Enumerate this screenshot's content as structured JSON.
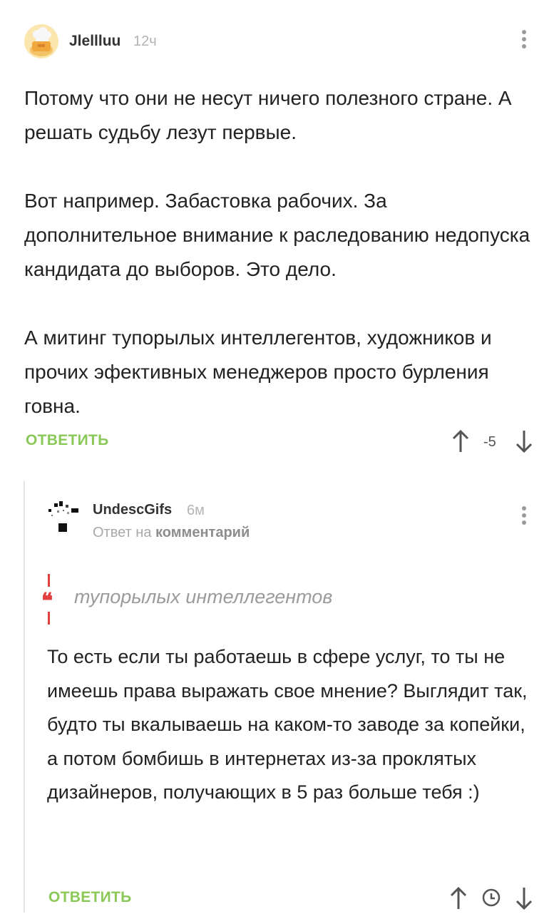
{
  "comment": {
    "username": "Jlellluu",
    "time": "12ч",
    "paragraphs": [
      "Потому что они не несут ничего полезного стране. А решать судьбу лезут первые.",
      "Вот например. Забастовка рабочих. За дополнительное внимание к раследованию недопуска кандидата до выборов. Это дело.",
      "А митинг тупорылых интеллегентов, художников и прочих эфективных менеджеров просто бурления говна."
    ],
    "reply_label": "ОТВЕТИТЬ",
    "score": "-5"
  },
  "reply": {
    "username": "UndescGifs",
    "time": "6м",
    "reply_to_prefix": "Ответ на",
    "reply_to_link": "комментарий",
    "quote": "тупорылых интеллегентов",
    "text": "То есть если ты работаешь в сфере услуг, то ты не имеешь права выражать свое мнение? Выглядит так, будто ты вкалываешь на каком-то заводе за копейки, а потом бомбишь в интернетах из-за проклятых дизайнеров, получающих в 5 раз больше тебя :)",
    "reply_label": "ОТВЕТИТЬ"
  },
  "icons": {
    "upvote": "arrow-up-icon",
    "downvote": "arrow-down-icon",
    "more": "kebab-menu-icon",
    "save": "clock-icon"
  },
  "colors": {
    "reply_green": "#8ac858",
    "quote_red": "#e33e3e",
    "meta_gray": "#b3b3b3"
  }
}
